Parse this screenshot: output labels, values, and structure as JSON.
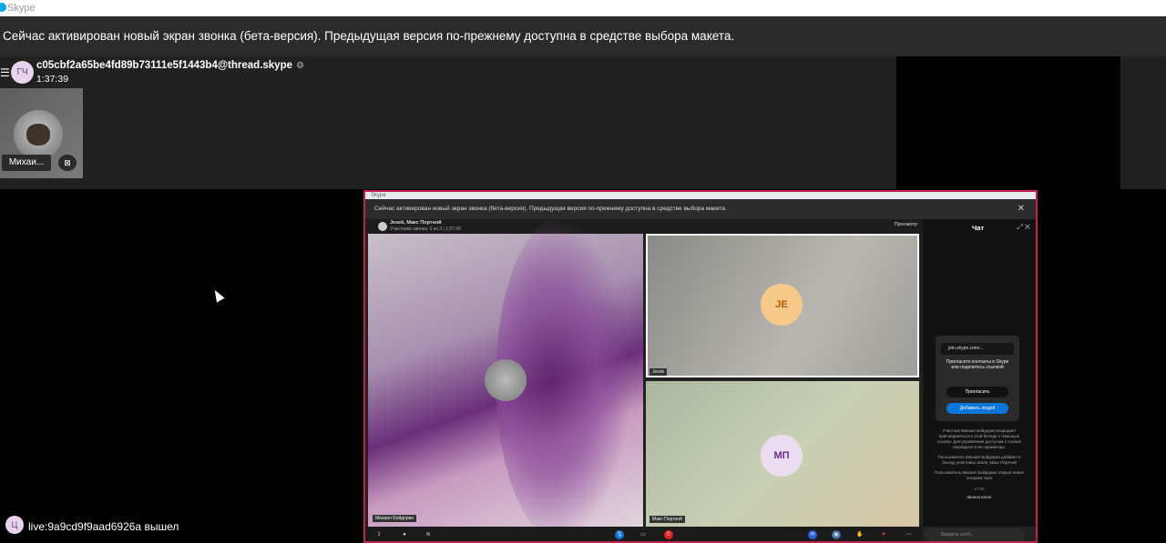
{
  "app": {
    "title": "Skype"
  },
  "banner": {
    "text": "Сейчас активирован новый экран звонка (бета-версия). Предыдущая версия по-прежнему доступна в средстве выбора макета."
  },
  "call": {
    "avatar_initials": "ГЧ",
    "thread_name": "c05cbf2a65be4fd89b73111e5f1443b4@thread.skype",
    "settings_icon": "⚙",
    "timer": "1:37:39"
  },
  "participant": {
    "name": "Михаи..."
  },
  "status": {
    "avatar_initials": "Ц",
    "message": "live:9a9cd9f9aad6926a вышел"
  },
  "shared_window": {
    "title": "Skype",
    "banner": "Сейчас активирован новый экран звонка (бета-версия). Предыдущая версия по-прежнему доступна в средстве выбора макета.",
    "header_names": "Jesek, Макс Портной",
    "header_sub": "Участники звонка: 3 из 3 | 1:37:43",
    "view_label": "Просмотр",
    "main_label": "Михаил Бойдорин",
    "tile1_initials": "JE",
    "tile1_label": "Jesek",
    "tile2_initials": "МП",
    "tile2_label": "Макс Портной",
    "chat_title": "Чат",
    "link": "join.skype.com/...",
    "invite_text": "Пригласите контакты в Skype или поделитесь ссылкой",
    "invite_button": "Пригласить",
    "add_people_button": "Добавить людей",
    "msg1": "Участник Михаил Бойдорин возродает присоединиться к этой беседе с помощью ссылки. Для управления доступом с ссылке перейдите в ее параметры.",
    "msg2": "Пользователь Михаил Бойдорин добавил в беседу участника Jesek, Макс Портной",
    "msg3": "Пользователь Михаил Бойдорин открыл новое позором чата",
    "time": "17:04",
    "missed": "Звонок начат",
    "input_placeholder": "Введите сооб..."
  }
}
